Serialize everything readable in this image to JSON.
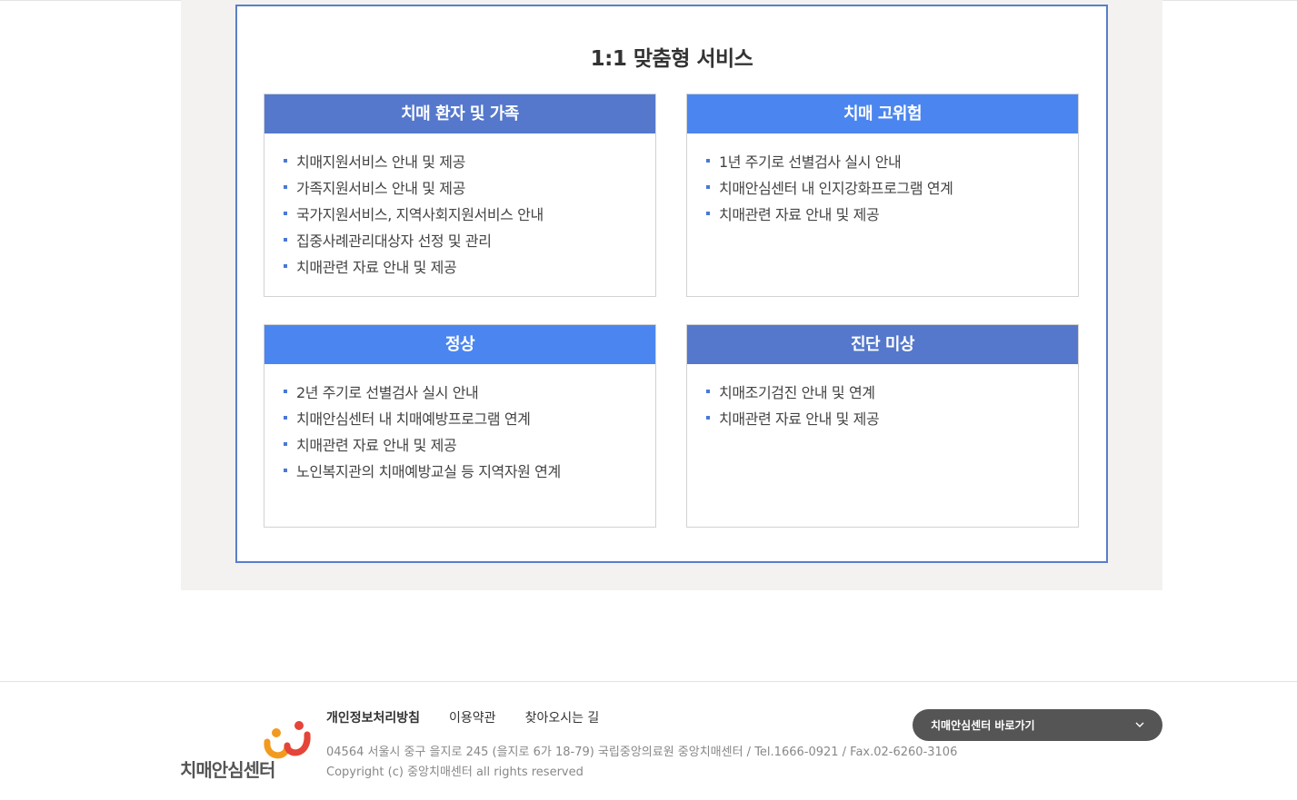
{
  "service": {
    "title": "1:1 맞춤형 서비스",
    "cards": [
      {
        "title": "치매 환자 및 가족",
        "header_color": "#5578cc",
        "items": [
          "치매지원서비스 안내 및 제공",
          "가족지원서비스 안내 및 제공",
          "국가지원서비스, 지역사회지원서비스 안내",
          "집중사례관리대상자 선정 및 관리",
          "치매관련 자료 안내 및 제공"
        ]
      },
      {
        "title": "치매 고위험",
        "header_color": "#4b86f0",
        "items": [
          "1년 주기로 선별검사 실시 안내",
          "치매안심센터 내 인지강화프로그램 연계",
          "치매관련 자료 안내 및 제공"
        ]
      },
      {
        "title": "정상",
        "header_color": "#4b86f0",
        "items": [
          "2년 주기로 선별검사 실시 안내",
          "치매안심센터 내 치매예방프로그램 연계",
          "치매관련 자료 안내 및 제공",
          "노인복지관의 치매예방교실 등 지역자원 연계"
        ]
      },
      {
        "title": "진단 미상",
        "header_color": "#5578cc",
        "items": [
          "치매조기검진 안내 및 연계",
          "치매관련 자료 안내 및 제공"
        ]
      }
    ]
  },
  "footer": {
    "logo_text": "치매안심센터",
    "links": [
      "개인정보처리방침",
      "이용약관",
      "찾아오시는 길"
    ],
    "address": "04564 서울시 중구 을지로 245 (을지로 6가 18-79) 국립중앙의료원 중앙치매센터 / Tel.1666-0921 / Fax.02-6260-3106",
    "copyright": "Copyright (c) 중앙치매센터 all rights reserved",
    "shortcut_label": "치매안심센터 바로가기",
    "shortcut_icon": "chevron-down-icon"
  },
  "colors": {
    "box_border": "#5a7ec9",
    "bullet": "#4a78d6",
    "logo_orange": "#f29a1f",
    "logo_red": "#e5443a"
  }
}
